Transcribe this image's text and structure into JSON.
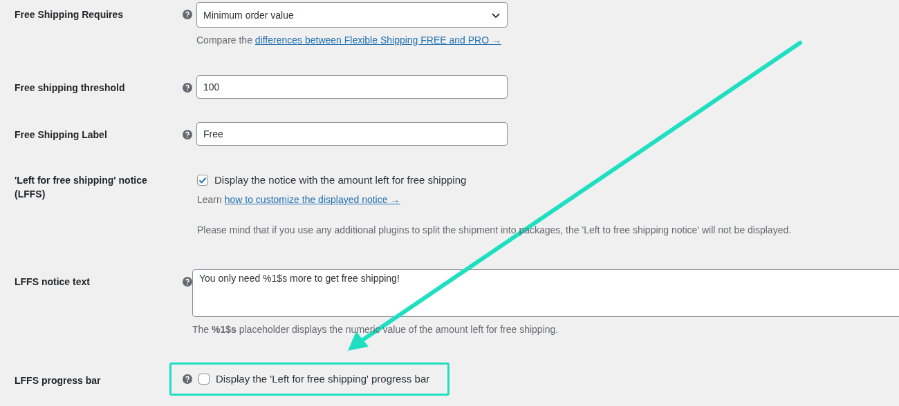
{
  "rows": [
    {
      "label": "Free Shipping Requires",
      "help": true,
      "highlighted": false,
      "kind": "select",
      "value": "Minimum order value",
      "description": {
        "prefix": "Compare the",
        "link": "differences between Flexible Shipping FREE and PRO →"
      }
    },
    {
      "label": "Free shipping threshold",
      "help": true,
      "highlighted": false,
      "kind": "input",
      "value": "100"
    },
    {
      "label": "Free Shipping Label",
      "help": true,
      "highlighted": false,
      "kind": "input",
      "value": "Free"
    },
    {
      "label": "'Left for free shipping' notice (LFFS)",
      "help": false,
      "highlighted": false,
      "kind": "checkbox",
      "checked": true,
      "option": "Display the notice with the amount left for free shipping",
      "learn": {
        "prefix": "Learn",
        "link": "how to customize the displayed notice →"
      },
      "note": "Please mind that if you use any additional plugins to split the shipment into packages, the 'Left to free shipping notice' will not be displayed."
    },
    {
      "label": "LFFS notice text",
      "help": true,
      "highlighted": false,
      "kind": "textarea",
      "value": "You only need %1$s more to get free shipping!",
      "note": "The **%1$s** placeholder displays the numeric value of the amount left for free shipping."
    },
    {
      "label": "LFFS progress bar",
      "help": true,
      "highlighted": true,
      "kind": "checkbox",
      "checked": false,
      "option": "Display the 'Left for free shipping' progress bar"
    }
  ]
}
